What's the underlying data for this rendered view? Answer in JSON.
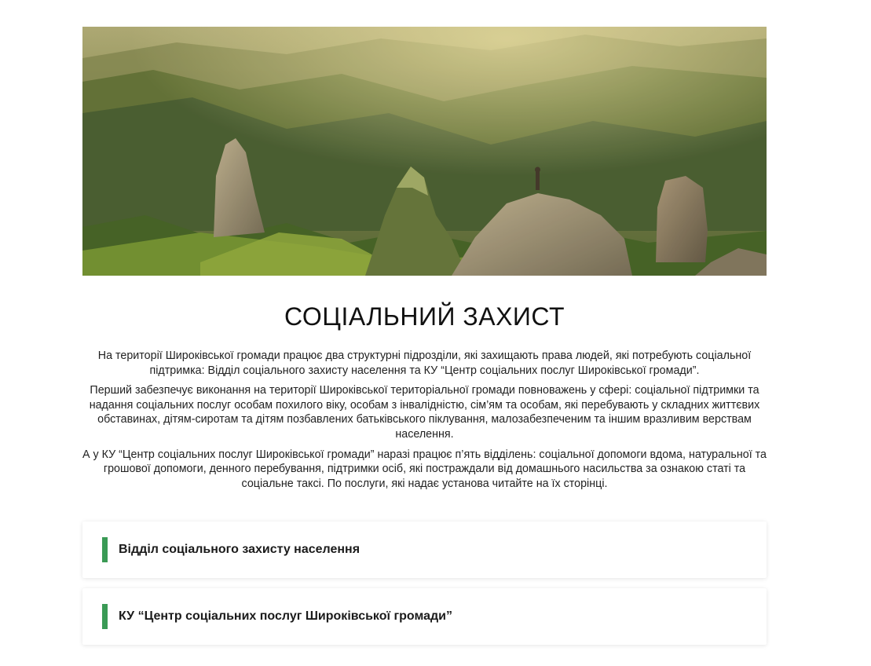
{
  "hero": {
    "image_name": "mountain-landscape-image"
  },
  "page_title": "СОЦІАЛЬНИЙ ЗАХИСТ",
  "intro": {
    "paragraphs": [
      "На території Широківської громади працює два структурні підрозділи, які захищають права людей, які потребують соціальної підтримка: Відділ соціального захисту населення та КУ “Центр соціальних послуг Широківської громади”.",
      "Перший забезпечує виконання на території Широківської територіальної громади повноважень у сфері: соціальної підтримки та надання соціальних послуг особам похилого віку, особам з інвалідністю, сім’ям та особам,  які перебувають у складних життєвих обставинах, дітям-сиротам та дітям позбавлених батьківського піклування, малозабезпеченим та іншим вразливим верствам населення.",
      "А у КУ “Центр соціальних послуг Широківської громади” наразі працює п’ять відділень: соціальної допомоги вдома, натуральної та грошової допомоги, денного перебування, підтримки осіб, які постраждали від домашнього насильства за ознакою статі та соціальне таксі. По послуги, які надає установа читайте на їх сторінці."
    ]
  },
  "accordion": {
    "items": [
      {
        "label": "Відділ соціального захисту населення"
      },
      {
        "label": "КУ “Центр соціальних послуг Широківської громади”"
      }
    ]
  },
  "colors": {
    "accent": "#3a9a55",
    "text": "#1a1a1a",
    "background": "#ffffff"
  }
}
